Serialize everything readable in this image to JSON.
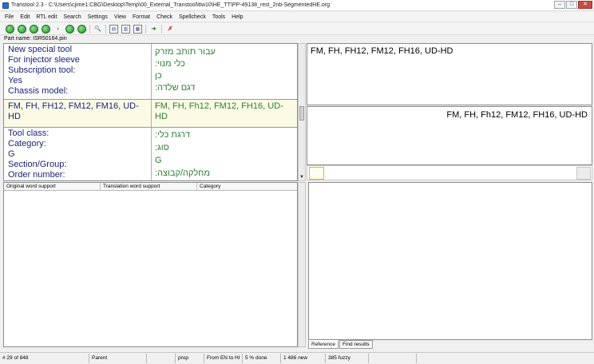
{
  "window": {
    "title": "Transtool 2.3 - C:\\Users\\cjime1.CBG\\Desktop\\Temp\\00_External_Transtool\\ttw10\\HE_TT\\PP-49138_rest_2nb-SegmentedHE.org",
    "buttons": {
      "minimize": "–",
      "maximize": "□",
      "close": "✕"
    }
  },
  "menu": [
    "File",
    "Edit",
    "RTL edit",
    "Search",
    "Settings",
    "View",
    "Format",
    "Check",
    "Spellcheck",
    "Tools",
    "Help"
  ],
  "toolbar": {
    "icons": [
      "first-icon",
      "previous-icon",
      "next-icon",
      "last-icon",
      "jump-icon",
      "go-back-icon",
      "go-forward-icon",
      "find-icon",
      "copy-doc-icon",
      "paste-doc-icon",
      "info-doc-icon",
      "export-icon",
      "delete-mark-icon"
    ],
    "glyphs": {
      "arrow": "›",
      "back": "◀",
      "forward": "▶",
      "find": "🔍",
      "doc1": "▤",
      "doc2": "▥",
      "doc3": "▦",
      "export": "➜",
      "delete": "✗"
    }
  },
  "part_name": "Part name: ISR50164.pin",
  "segments": {
    "top_source": [
      "New special tool",
      "For injector sleeve",
      "Subscription tool:",
      "Yes",
      "Chassis model:"
    ],
    "top_target": [
      "עבור תותב מזרק",
      "כלי מנוי:",
      "כן",
      "דגם שלדה:"
    ],
    "current_source": "FM, FH, FH12, FM12, FM16, UD-HD",
    "current_target": "FM, FH, Fh12, FM12, FH16, UD-HD",
    "bottom_source": [
      "Tool class:",
      "Category:",
      "G",
      "Section/Group:",
      "Order number:"
    ],
    "bottom_target": [
      "דרגת כלי:",
      "סוג:",
      "G",
      "מחלקה/קבוצה:"
    ]
  },
  "editor": {
    "source_text": "FM, FH, FH12, FM12, FH16, UD-HD",
    "target_text": "FM, FH, Fh12, FM12, FH16, UD-HD"
  },
  "word_support": {
    "columns": [
      "Original word support",
      "Translation word support",
      "Category"
    ]
  },
  "reference_tabs": [
    "Reference",
    "Find results"
  ],
  "status": {
    "position": "# 29 of 848",
    "parent": "Parent",
    "prop": "prop",
    "direction": "From EN to HI",
    "progress": "5 % done",
    "new_count": "1 486 new",
    "fuzzy_count": "385 fuzzy"
  },
  "colors": {
    "source_text": "#1a237e",
    "target_text": "#2e7d32",
    "current_segment_bg": "#fbfbe5",
    "toolbar_green": "#1f8f2a",
    "cursor_cell_border": "#e1c100"
  }
}
